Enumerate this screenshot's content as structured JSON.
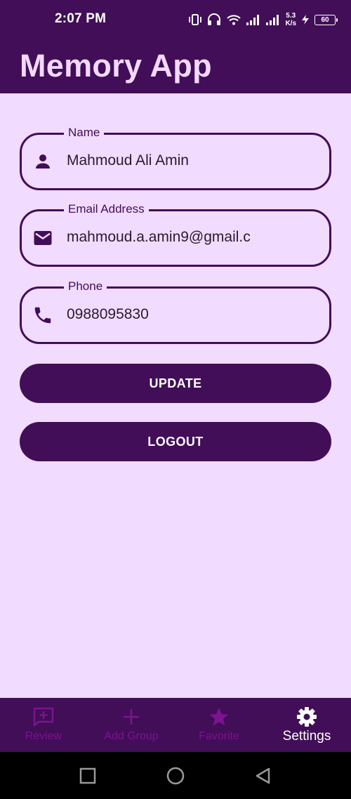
{
  "status_bar": {
    "time": "2:07 PM",
    "speed_value": "5.3",
    "speed_unit": "K/s",
    "battery": "60"
  },
  "app_bar": {
    "title": "Memory App"
  },
  "form": {
    "name": {
      "label": "Name",
      "value": "Mahmoud Ali Amin",
      "icon": "person-icon"
    },
    "email": {
      "label": "Email Address",
      "value": "mahmoud.a.amin9@gmail.c",
      "icon": "mail-icon"
    },
    "phone": {
      "label": "Phone",
      "value": "0988095830",
      "icon": "phone-icon"
    }
  },
  "buttons": {
    "update": "UPDATE",
    "logout": "LOGOUT"
  },
  "bottom_nav": {
    "items": [
      {
        "label": "Review",
        "icon": "review-icon",
        "active": false
      },
      {
        "label": "Add Group",
        "icon": "plus-icon",
        "active": false
      },
      {
        "label": "Favorite",
        "icon": "star-icon",
        "active": false
      },
      {
        "label": "Settings",
        "icon": "gear-icon",
        "active": true
      }
    ]
  },
  "colors": {
    "primary": "#410e57",
    "background": "#f1dbff",
    "inactive_nav": "#7c1390"
  }
}
